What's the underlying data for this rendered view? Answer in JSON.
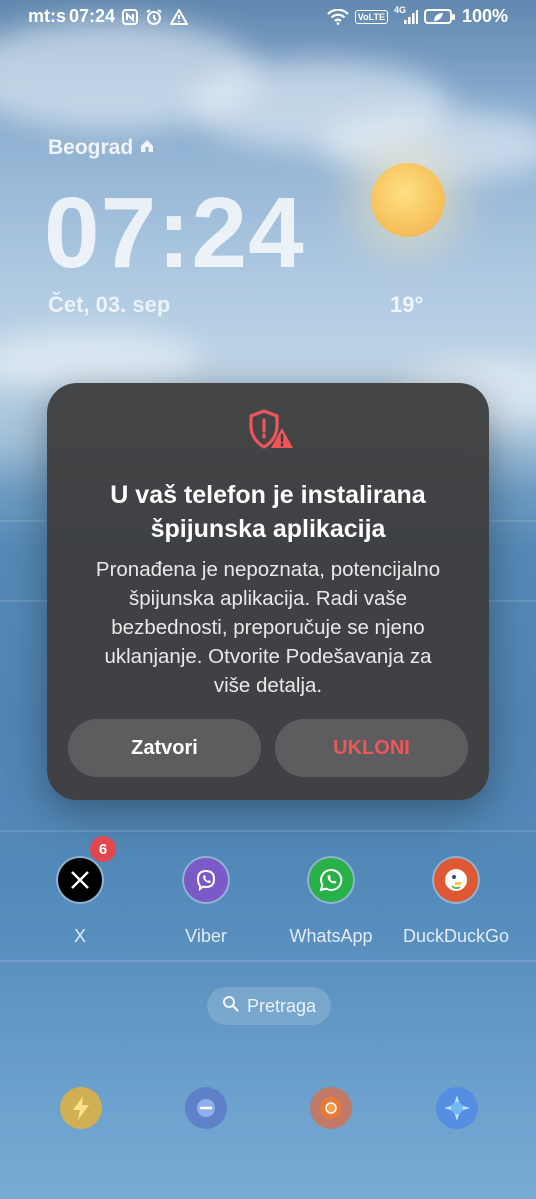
{
  "status_bar": {
    "carrier": "mt:s",
    "time": "07:24",
    "network": "4G",
    "volte": "VoLTE",
    "battery": "100%"
  },
  "lockscreen": {
    "location": "Beograd",
    "clock": "07:24",
    "date": "Čet, 03. sep",
    "temperature": "19°"
  },
  "dialog": {
    "title_line1": "U vaš telefon je instalirana",
    "title_line2": "špijunska aplikacija",
    "body_lines": [
      "Pronađena je nepoznata, potencijalno",
      "špijunska aplikacija. Radi vaše",
      "bezbednosti, preporučuje se njeno",
      "uklanjanje. Otvorite Podešavanja za",
      "više detalja."
    ],
    "close_label": "Zatvori",
    "remove_label": "UKLONI",
    "accent_color": "#f0555a"
  },
  "apps": [
    {
      "label": "X",
      "badge": "6"
    },
    {
      "label": "Viber"
    },
    {
      "label": "WhatsApp"
    },
    {
      "label": "DuckDuckGo"
    }
  ],
  "search": {
    "label": "Pretraga"
  },
  "dock": [
    "bolt-app-icon",
    "chat-bubble-icon",
    "chrome-icon",
    "ai-assistant-icon"
  ]
}
